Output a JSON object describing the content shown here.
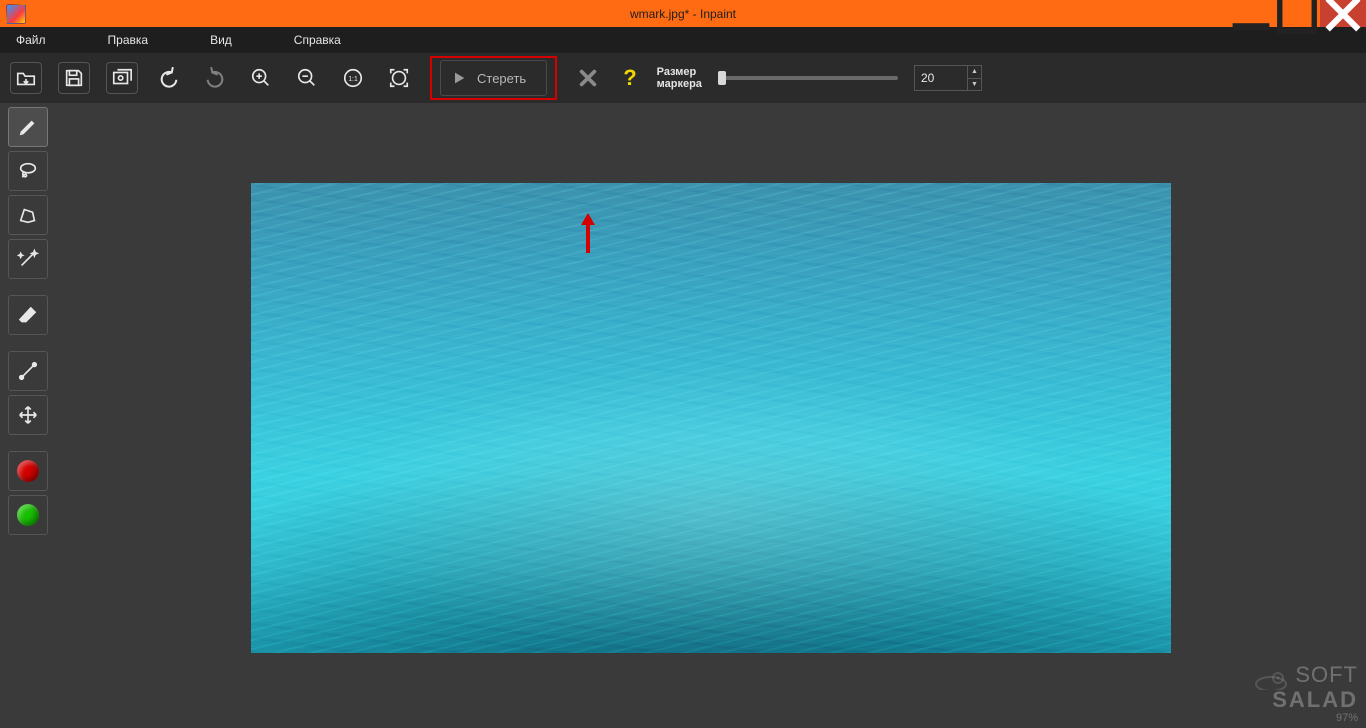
{
  "title": "wmark.jpg* - Inpaint",
  "menu": {
    "file": "Файл",
    "edit": "Правка",
    "view": "Вид",
    "help": "Справка"
  },
  "toolbar": {
    "erase": "Стереть",
    "marker_label_l1": "Размер",
    "marker_label_l2": "маркера",
    "marker_size": "20"
  },
  "watermark": {
    "line1": "SOFT",
    "line2": "SALAD",
    "pct": "97%"
  },
  "sidebar": {
    "color_red": "#d40000",
    "color_green": "#17c000"
  }
}
